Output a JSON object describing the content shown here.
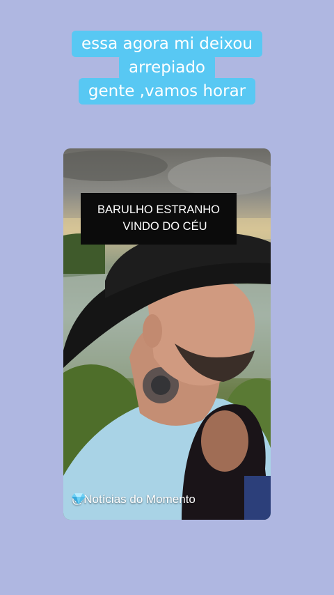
{
  "caption": {
    "lines": [
      "essa agora mi deixou",
      "arrepiado",
      "gente ,vamos horar"
    ]
  },
  "video": {
    "overlay_title_line1": "BARULHO ESTRANHO",
    "overlay_title_line2": "VINDO DO CÉU",
    "watermark": "@Notícias do Momento",
    "watermark_icon": "gem-icon"
  },
  "colors": {
    "background": "#afb7e1",
    "caption_highlight": "#58c8f3",
    "caption_text": "#ffffff",
    "overlay_box": "#0b0b0b"
  }
}
